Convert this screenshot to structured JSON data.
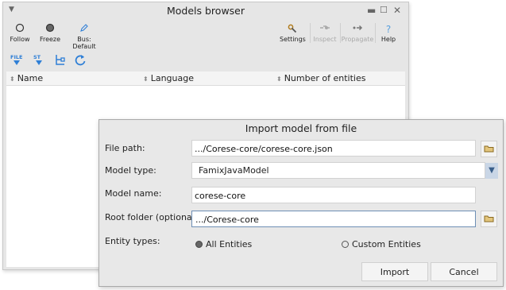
{
  "browser": {
    "title": "Models browser",
    "toolbar": {
      "follow": "Follow",
      "freeze": "Freeze",
      "bus": "Bus: Default",
      "settings": "Settings",
      "inspect": "Inspect",
      "propagate": "Propagate",
      "help": "Help"
    },
    "small_icons": [
      "import-mse-icon",
      "import-st-icon",
      "tree-icon",
      "refresh-icon"
    ],
    "small_icon_labels": {
      "file": "FILE",
      "st": "ST"
    },
    "columns": [
      "Name",
      "Language",
      "Number of entities"
    ],
    "window_icons": [
      "menu-arrow-icon",
      "minimize-icon",
      "maximize-icon",
      "close-icon"
    ]
  },
  "dialog": {
    "title": "Import model from file",
    "labels": {
      "file_path": "File path:",
      "model_type": "Model type:",
      "model_name": "Model name:",
      "root_folder": "Root folder (optional):",
      "entity_types": "Entity types:"
    },
    "values": {
      "file_path": ".../Corese-core/corese-core.json",
      "model_type": "FamixJavaModel",
      "model_name": "corese-core",
      "root_folder": ".../Corese-core"
    },
    "radio": {
      "all": "All Entities",
      "custom": "Custom Entities",
      "selected": "All Entities"
    },
    "buttons": {
      "import": "Import",
      "cancel": "Cancel"
    },
    "colors": {
      "focus_border": "#6e8fb5",
      "select_arrow_bg": "#c9d6e6",
      "icon_blue": "#2f7fd6"
    }
  }
}
